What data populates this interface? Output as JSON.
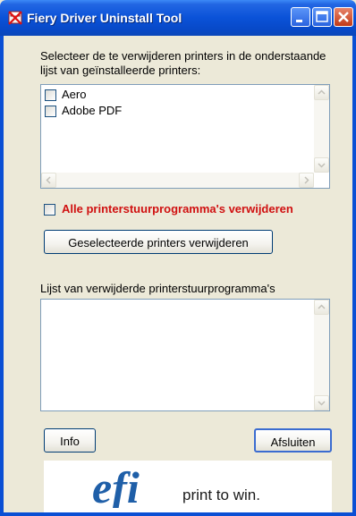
{
  "window": {
    "title": "Fiery Driver Uninstall Tool",
    "icon": "fiery-app-icon",
    "controls": [
      "minimize-icon",
      "maximize-icon",
      "close-icon"
    ]
  },
  "instructions": "Selecteer de te verwijderen printers in de onderstaande lijst van geïnstalleerde printers:",
  "printers": [
    {
      "label": "Aero",
      "checked": false
    },
    {
      "label": "Adobe PDF",
      "checked": false
    }
  ],
  "remove_all": {
    "label": "Alle printerstuurprogramma's verwijderen",
    "checked": false,
    "color": "#d01010"
  },
  "buttons": {
    "remove_selected": "Geselecteerde printers verwijderen",
    "info": "Info",
    "close": "Afsluiten"
  },
  "removed_list": {
    "label": "Lijst van verwijderde printerstuurprogramma's",
    "items": []
  },
  "logo": {
    "brand": "efi",
    "tagline": "print to win.",
    "color": "#1f5fa8"
  }
}
